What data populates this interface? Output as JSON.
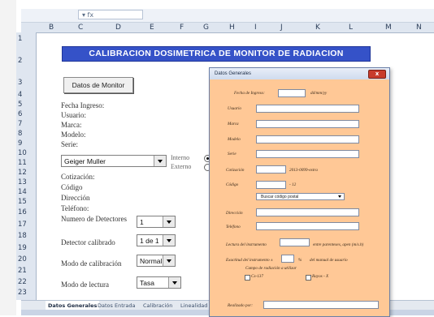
{
  "formula_bar": {
    "namebox_text": "▾ fx"
  },
  "columns": [
    "B",
    "C",
    "D",
    "E",
    "F",
    "G",
    "H",
    "I",
    "J",
    "K",
    "L",
    "M",
    "N"
  ],
  "rows": [
    "1",
    "2",
    "3",
    "4",
    "5",
    "6",
    "7",
    "8",
    "9",
    "10",
    "11",
    "12",
    "13",
    "14",
    "15",
    "16",
    "17",
    "18",
    "19",
    "20",
    "21",
    "22",
    "23"
  ],
  "sheet": {
    "title": "CALIBRACION DOSIMETRICA DE MONITOR DE RADIACION",
    "datos_button": "Datos de Monitor",
    "labels": {
      "fecha": "Fecha Ingreso:",
      "usuario": "Usuario:",
      "marca": "Marca:",
      "modelo": "Modelo:",
      "serie": "Serie:",
      "cotizacion": "Cotización:",
      "codigo": "Código",
      "direccion": "Dirección",
      "telefono": "Teléfono:",
      "num_detectores": "Numero de Detectores",
      "detector_calibrado": "Detector calibrado",
      "modo_calibracion": "Modo de calibración",
      "modo_lectura": "Modo de lectura",
      "interno": "Interno",
      "externo": "Externo"
    },
    "combo_detector": "Geiger Muller",
    "combo_num": "1",
    "combo_calibrado": "1 de 1",
    "combo_modo_cal": "Normal",
    "combo_modo_lectura": "Tasa"
  },
  "tabs": [
    "Datos Generales",
    "Datos Entrada",
    "Calibración",
    "Linealidad"
  ],
  "dialog": {
    "title": "Datos Generales",
    "close": "x",
    "fields": {
      "fecha": "Fecha de Ingreso:",
      "fecha_hint": "dd/mm/yy",
      "usuario": "Usuario",
      "marca": "Marca",
      "modelo": "Modelo",
      "serie": "Serie",
      "cotizacion": "Cotización",
      "cotizacion_hint": "2013-0099-extra",
      "codigo": "Código",
      "codigo_hint": "- 12",
      "buscar": "Buscar código postal",
      "direccion": "Dirección",
      "telefono": "Teléfono",
      "lectura": "Lectura del instrumento",
      "lectura_hint": "entre parenteses, apen (m/s.h)",
      "exactitud": "Exactitud del instrumento ±",
      "exactitud_unit": "%",
      "exactitud_hint": "del manual de usuario",
      "campo": "Campo de radiación a utilizar",
      "cs137": "Cs-137",
      "rayos_x": "Rayos - X",
      "realizado": "Realizado por:"
    }
  },
  "colors": {
    "title_bg": "#3552c8",
    "dialog_bg": "#ffc896",
    "header_bg": "#dfe6f0"
  }
}
